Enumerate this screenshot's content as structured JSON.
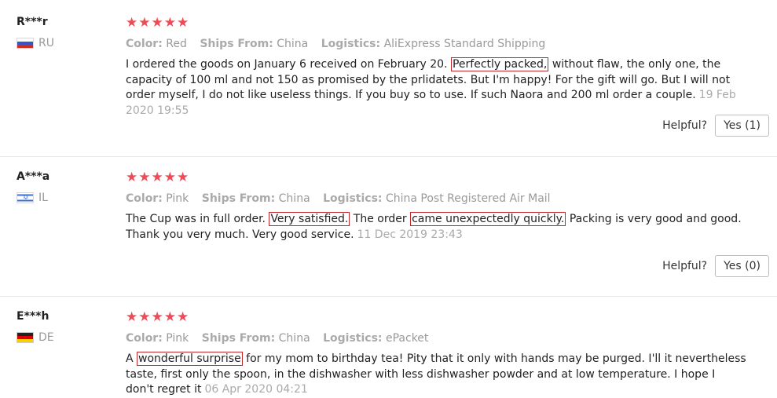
{
  "reviews": [
    {
      "user": "R***r",
      "country_code": "RU",
      "stars": "★★★★★",
      "color_label": "Color:",
      "color": "Red",
      "ships_label": "Ships From:",
      "ships": "China",
      "logistics_label": "Logistics:",
      "logistics": "AliExpress Standard Shipping",
      "text_parts": [
        "I ordered the goods on January 6 received on February 20. ",
        "Perfectly packed,",
        " without flaw, the only one, the capacity of 100 ml and not 150 as promised by the prlidatets. But I'm happy! For the gift will go. But I will not order myself, I do not like useless things. If you buy so to use. If such Naora and 200 ml order a couple."
      ],
      "date": "19 Feb 2020 19:55",
      "helpful_label": "Helpful?",
      "yes_label": "Yes (1)"
    },
    {
      "user": "A***a",
      "country_code": "IL",
      "stars": "★★★★★",
      "color_label": "Color:",
      "color": "Pink",
      "ships_label": "Ships From:",
      "ships": "China",
      "logistics_label": "Logistics:",
      "logistics": "China Post Registered Air Mail",
      "text_parts": [
        "The Cup was in full order. ",
        "Very satisfied.",
        " The order ",
        "came unexpectedly quickly.",
        " Packing is very good and good. Thank you very much. Very good service."
      ],
      "date": "11 Dec 2019 23:43",
      "helpful_label": "Helpful?",
      "yes_label": "Yes (0)"
    },
    {
      "user": "E***h",
      "country_code": "DE",
      "stars": "★★★★★",
      "color_label": "Color:",
      "color": "Pink",
      "ships_label": "Ships From:",
      "ships": "China",
      "logistics_label": "Logistics:",
      "logistics": "ePacket",
      "text_parts": [
        "A ",
        "wonderful surprise",
        " for my mom to birthday tea! Pity that it only with hands may be purged. I'll it nevertheless taste, first only the spoon, in the dishwasher with less dishwasher powder and at low temperature. I hope I don't regret it"
      ],
      "date": "06 Apr 2020 04:21"
    }
  ]
}
